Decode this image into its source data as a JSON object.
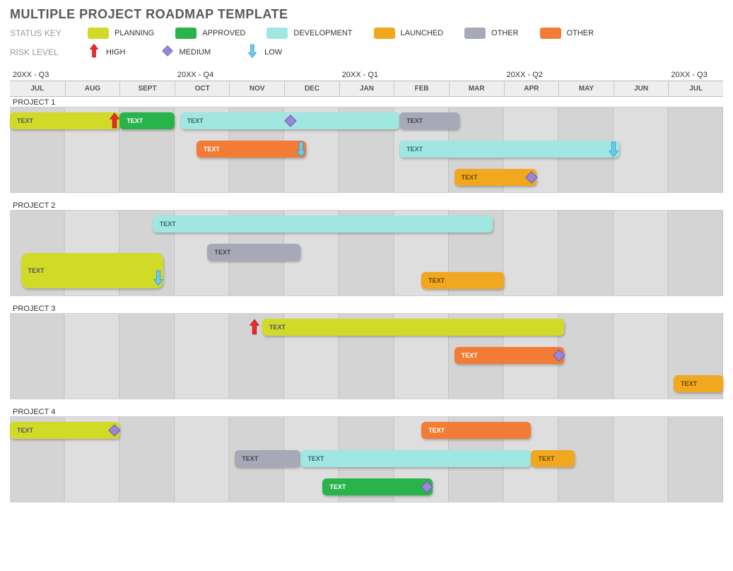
{
  "title": "MULTIPLE PROJECT ROADMAP TEMPLATE",
  "status_key_label": "STATUS KEY",
  "risk_level_label": "RISK LEVEL",
  "statuses": [
    {
      "name": "PLANNING",
      "color": "#d1da26",
      "class": "c-planning"
    },
    {
      "name": "APPROVED",
      "color": "#28b34b",
      "class": "c-approved"
    },
    {
      "name": "DEVELOPMENT",
      "color": "#a0e7e1",
      "class": "c-development"
    },
    {
      "name": "LAUNCHED",
      "color": "#f1a81f",
      "class": "c-launched"
    },
    {
      "name": "OTHER",
      "color": "#a8a9b8",
      "class": "c-other1"
    },
    {
      "name": "OTHER",
      "color": "#f27c36",
      "class": "c-other2"
    }
  ],
  "risks": [
    {
      "name": "HIGH",
      "kind": "high"
    },
    {
      "name": "MEDIUM",
      "kind": "medium"
    },
    {
      "name": "LOW",
      "kind": "low"
    }
  ],
  "quarters": [
    {
      "label": "20XX - Q3",
      "col": 0
    },
    {
      "label": "20XX - Q4",
      "col": 3
    },
    {
      "label": "20XX - Q1",
      "col": 6
    },
    {
      "label": "20XX - Q2",
      "col": 9
    },
    {
      "label": "20XX - Q3",
      "col": 12
    }
  ],
  "months": [
    "JUL",
    "AUG",
    "SEPT",
    "OCT",
    "NOV",
    "DEC",
    "JAN",
    "FEB",
    "MAR",
    "APR",
    "MAY",
    "JUN",
    "JUL"
  ],
  "projects": [
    {
      "name": "PROJECT 1",
      "lanes": [
        {
          "bars": [
            {
              "label": "TEXT",
              "class": "c-planning",
              "start": 0,
              "span": 2,
              "risk": "high",
              "risk_at": "end"
            },
            {
              "label": "TEXT",
              "class": "c-approved",
              "start": 2,
              "span": 1
            },
            {
              "label": "TEXT",
              "class": "c-development",
              "start": 3.1,
              "span": 4,
              "risk": "medium",
              "risk_at": "mid"
            },
            {
              "label": "TEXT",
              "class": "c-other1",
              "start": 7.1,
              "span": 1.1
            }
          ]
        },
        {
          "bars": [
            {
              "label": "TEXT",
              "class": "c-other2",
              "start": 3.4,
              "span": 2,
              "risk": "low",
              "risk_at": "end"
            },
            {
              "label": "TEXT",
              "class": "c-development",
              "start": 7.1,
              "span": 4,
              "risk": "low",
              "risk_at": "end"
            }
          ]
        },
        {
          "bars": [
            {
              "label": "TEXT",
              "class": "c-launched",
              "start": 8.1,
              "span": 1.5,
              "risk": "medium",
              "risk_at": "end"
            }
          ]
        }
      ]
    },
    {
      "name": "PROJECT 2",
      "lanes": [
        {
          "bars": [
            {
              "label": "TEXT",
              "class": "c-development",
              "start": 2.6,
              "span": 6.2
            }
          ]
        },
        {
          "bars": [
            {
              "label": "TEXT",
              "class": "c-other1",
              "start": 3.6,
              "span": 1.7
            }
          ]
        },
        {
          "bars": [
            {
              "label": "TEXT",
              "class": "c-planning",
              "start": 0.2,
              "span": 2.6,
              "risk": "low",
              "risk_at": "end",
              "tall": true
            },
            {
              "label": "TEXT",
              "class": "c-launched",
              "start": 7.5,
              "span": 1.5
            }
          ]
        }
      ]
    },
    {
      "name": "PROJECT 3",
      "lanes": [
        {
          "bars": [
            {
              "label": "TEXT",
              "class": "c-planning",
              "start": 4.6,
              "span": 5.5,
              "risk": "high",
              "risk_at": "start"
            }
          ]
        },
        {
          "bars": [
            {
              "label": "TEXT",
              "class": "c-other2",
              "start": 8.1,
              "span": 2,
              "risk": "medium",
              "risk_at": "end"
            }
          ]
        },
        {
          "bars": [
            {
              "label": "TEXT",
              "class": "c-launched",
              "start": 12.1,
              "span": 0.9
            }
          ]
        }
      ]
    },
    {
      "name": "PROJECT 4",
      "lanes": [
        {
          "bars": [
            {
              "label": "TEXT",
              "class": "c-planning",
              "start": 0,
              "span": 2,
              "risk": "medium",
              "risk_at": "end"
            },
            {
              "label": "TEXT",
              "class": "c-other2",
              "start": 7.5,
              "span": 2
            }
          ]
        },
        {
          "bars": [
            {
              "label": "TEXT",
              "class": "c-other1",
              "start": 4.1,
              "span": 1.2
            },
            {
              "label": "TEXT",
              "class": "c-development",
              "start": 5.3,
              "span": 4.2
            },
            {
              "label": "TEXT",
              "class": "c-launched",
              "start": 9.5,
              "span": 0.8
            }
          ]
        },
        {
          "bars": [
            {
              "label": "TEXT",
              "class": "c-approved",
              "start": 5.7,
              "span": 2,
              "risk": "medium",
              "risk_at": "end"
            }
          ]
        }
      ]
    }
  ],
  "chart_data": {
    "type": "gantt",
    "title": "MULTIPLE PROJECT ROADMAP TEMPLATE",
    "time_axis": {
      "months": [
        "JUL",
        "AUG",
        "SEPT",
        "OCT",
        "NOV",
        "DEC",
        "JAN",
        "FEB",
        "MAR",
        "APR",
        "MAY",
        "JUN",
        "JUL"
      ],
      "quarters": [
        "20XX - Q3",
        "20XX - Q4",
        "20XX - Q1",
        "20XX - Q2",
        "20XX - Q3"
      ]
    },
    "series": [
      {
        "project": "PROJECT 1",
        "task": "TEXT",
        "status": "PLANNING",
        "start_month": 0,
        "end_month": 2,
        "risk": "HIGH"
      },
      {
        "project": "PROJECT 1",
        "task": "TEXT",
        "status": "APPROVED",
        "start_month": 2,
        "end_month": 3
      },
      {
        "project": "PROJECT 1",
        "task": "TEXT",
        "status": "DEVELOPMENT",
        "start_month": 3.1,
        "end_month": 7.1,
        "risk": "MEDIUM"
      },
      {
        "project": "PROJECT 1",
        "task": "TEXT",
        "status": "OTHER",
        "start_month": 7.1,
        "end_month": 8.2
      },
      {
        "project": "PROJECT 1",
        "task": "TEXT",
        "status": "OTHER",
        "start_month": 3.4,
        "end_month": 5.4,
        "risk": "LOW"
      },
      {
        "project": "PROJECT 1",
        "task": "TEXT",
        "status": "DEVELOPMENT",
        "start_month": 7.1,
        "end_month": 11.1,
        "risk": "LOW"
      },
      {
        "project": "PROJECT 1",
        "task": "TEXT",
        "status": "LAUNCHED",
        "start_month": 8.1,
        "end_month": 9.6,
        "risk": "MEDIUM"
      },
      {
        "project": "PROJECT 2",
        "task": "TEXT",
        "status": "DEVELOPMENT",
        "start_month": 2.6,
        "end_month": 8.8
      },
      {
        "project": "PROJECT 2",
        "task": "TEXT",
        "status": "OTHER",
        "start_month": 3.6,
        "end_month": 5.3
      },
      {
        "project": "PROJECT 2",
        "task": "TEXT",
        "status": "PLANNING",
        "start_month": 0.2,
        "end_month": 2.8,
        "risk": "LOW"
      },
      {
        "project": "PROJECT 2",
        "task": "TEXT",
        "status": "LAUNCHED",
        "start_month": 7.5,
        "end_month": 9.0
      },
      {
        "project": "PROJECT 3",
        "task": "TEXT",
        "status": "PLANNING",
        "start_month": 4.6,
        "end_month": 10.1,
        "risk": "HIGH"
      },
      {
        "project": "PROJECT 3",
        "task": "TEXT",
        "status": "OTHER",
        "start_month": 8.1,
        "end_month": 10.1,
        "risk": "MEDIUM"
      },
      {
        "project": "PROJECT 3",
        "task": "TEXT",
        "status": "LAUNCHED",
        "start_month": 12.1,
        "end_month": 13.0
      },
      {
        "project": "PROJECT 4",
        "task": "TEXT",
        "status": "PLANNING",
        "start_month": 0,
        "end_month": 2,
        "risk": "MEDIUM"
      },
      {
        "project": "PROJECT 4",
        "task": "TEXT",
        "status": "OTHER",
        "start_month": 7.5,
        "end_month": 9.5
      },
      {
        "project": "PROJECT 4",
        "task": "TEXT",
        "status": "OTHER",
        "start_month": 4.1,
        "end_month": 5.3
      },
      {
        "project": "PROJECT 4",
        "task": "TEXT",
        "status": "DEVELOPMENT",
        "start_month": 5.3,
        "end_month": 9.5
      },
      {
        "project": "PROJECT 4",
        "task": "TEXT",
        "status": "LAUNCHED",
        "start_month": 9.5,
        "end_month": 10.3
      },
      {
        "project": "PROJECT 4",
        "task": "TEXT",
        "status": "APPROVED",
        "start_month": 5.7,
        "end_month": 7.7,
        "risk": "MEDIUM"
      }
    ],
    "legend_status": [
      "PLANNING",
      "APPROVED",
      "DEVELOPMENT",
      "LAUNCHED",
      "OTHER",
      "OTHER"
    ],
    "legend_risk": [
      "HIGH",
      "MEDIUM",
      "LOW"
    ]
  }
}
